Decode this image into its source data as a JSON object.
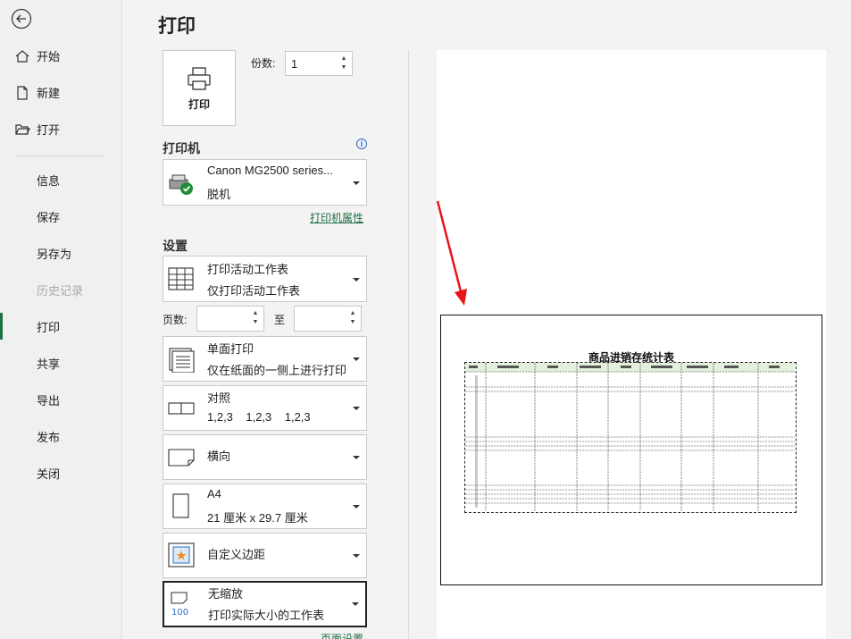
{
  "sidebar": {
    "items": [
      {
        "label": "开始",
        "icon": "home-icon"
      },
      {
        "label": "新建",
        "icon": "new-document-icon"
      },
      {
        "label": "打开",
        "icon": "folder-open-icon"
      },
      {
        "label": "信息"
      },
      {
        "label": "保存"
      },
      {
        "label": "另存为"
      },
      {
        "label": "历史记录",
        "disabled": true
      },
      {
        "label": "打印",
        "active": true
      },
      {
        "label": "共享"
      },
      {
        "label": "导出"
      },
      {
        "label": "发布"
      },
      {
        "label": "关闭"
      }
    ]
  },
  "main": {
    "title": "打印",
    "print_button": "打印",
    "copies_label": "份数:",
    "copies_value": "1",
    "printer_section": "打印机",
    "printer": {
      "name": "Canon MG2500 series...",
      "status": "脱机"
    },
    "printer_properties_link": "打印机属性",
    "settings_section": "设置",
    "settings": [
      {
        "line1": "打印活动工作表",
        "line2": "仅打印活动工作表"
      },
      {
        "line1": "单面打印",
        "line2": "仅在纸面的一侧上进行打印"
      },
      {
        "line1": "对照",
        "line2": "1,2,3    1,2,3    1,2,3"
      },
      {
        "line1": "横向",
        "line2": ""
      },
      {
        "line1": "A4",
        "line2": "21 厘米 x 29.7 厘米"
      },
      {
        "line1": "自定义边距",
        "line2": ""
      },
      {
        "line1": "无缩放",
        "line2": "打印实际大小的工作表"
      }
    ],
    "pages_label": "页数:",
    "pages_to": "至",
    "page_setup_link": "页面设置"
  },
  "preview": {
    "sheet_title": "商品进销存统计表",
    "accent_color": "#1e7145",
    "arrow_color": "#e8141a"
  }
}
